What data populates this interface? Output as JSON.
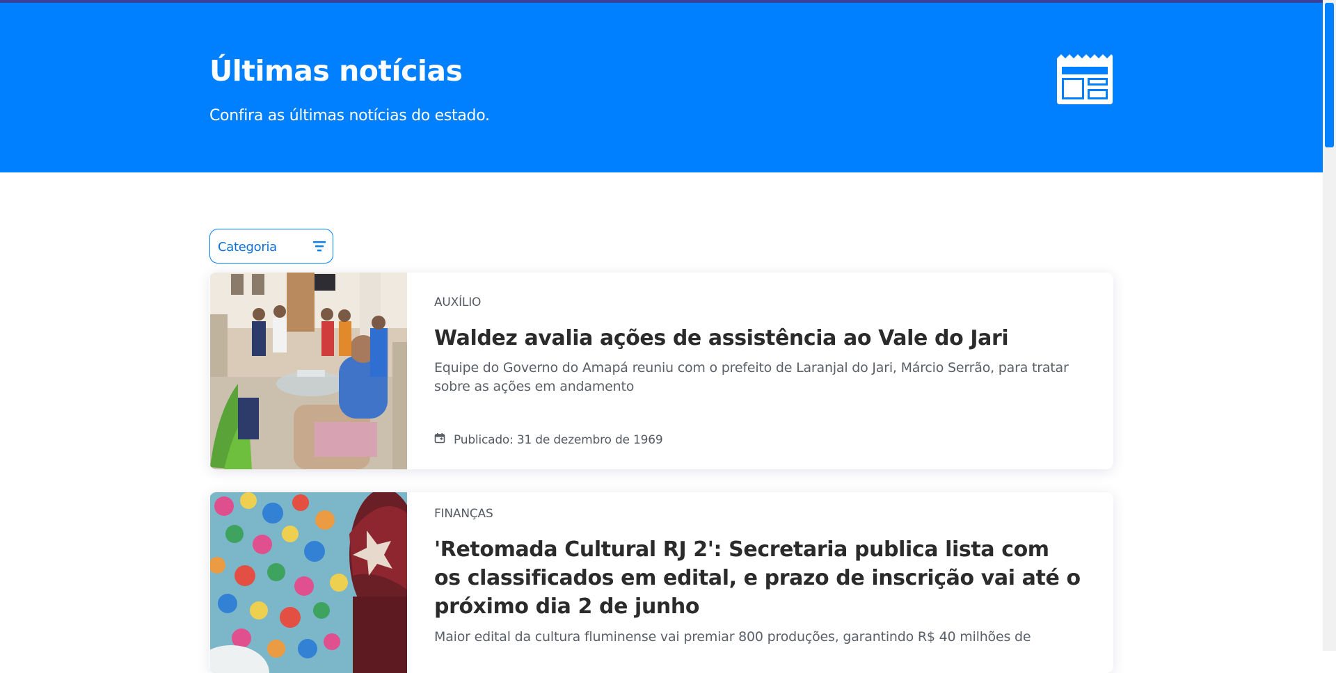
{
  "header": {
    "title": "Últimas notícias",
    "subtitle": "Confira as últimas notícias do estado.",
    "icon": "newspaper-icon"
  },
  "filter": {
    "label": "Categoria",
    "icon": "filter-icon"
  },
  "articles": [
    {
      "category": "AUXÍLIO",
      "title": "Waldez avalia ações de assistência ao Vale do Jari",
      "description": "Equipe do Governo do Amapá reuniu com o prefeito de Laranjal do Jari, Márcio Serrão, para tratar sobre as ações em andamento",
      "date": "Publicado: 31 de dezembro de 1969",
      "date_icon": "calendar-icon"
    },
    {
      "category": "FINANÇAS",
      "title": "'Retomada Cultural RJ 2': Secretaria publica lista com os classificados em edital, e prazo de inscrição vai até o próximo dia 2 de junho",
      "description": "Maior edital da cultura fluminense vai premiar 800 produções, garantindo R$ 40 milhões de"
    }
  ],
  "colors": {
    "primary": "#0080ff",
    "text_dark": "#2b2b2b",
    "text_muted": "#5a5f68"
  }
}
